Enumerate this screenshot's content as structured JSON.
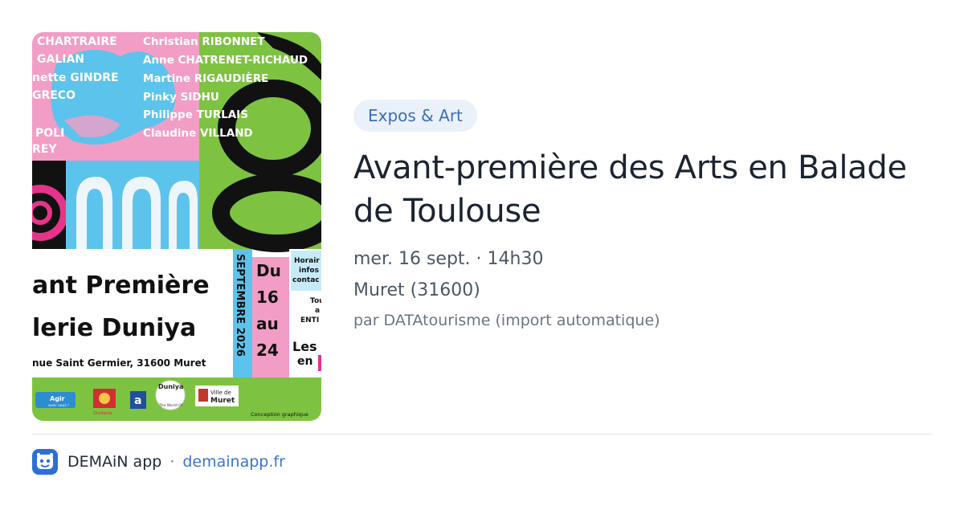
{
  "poster": {
    "names_left": [
      "CHARTRAIRE",
      "GALIAN",
      "nette GINDRE",
      "GRECO",
      "POLI",
      "REY"
    ],
    "names_right": [
      "Christian RIBONNET",
      "Anne CHATRENET-RICHAUD",
      "Martine RIGAUDIÈRE",
      "Pinky SIDHU",
      "Philippe TURLAIS",
      "Claudine VILLAND"
    ],
    "headline_1": "ant Première",
    "headline_2": "lerie Duniya",
    "address": "nue Saint Germier, 31600 Muret",
    "month_vertical": "SEPTEMBRE 2026",
    "date_du": "Du",
    "date_16": "16",
    "date_au": "au",
    "date_24": "24",
    "side_1": "Horair",
    "side_2": "infos",
    "side_3": "contac",
    "side_4": "Tou",
    "side_5": "a",
    "side_6": "ENTI",
    "side_7": "Les",
    "side_8": "en",
    "logo_agir": "Agir",
    "logo_agir_sub": "avec vous !",
    "logo_occitanie": "Occitanie",
    "logo_a": "a",
    "logo_duniya": "Duniya",
    "logo_duniya_sub": "The World Of",
    "logo_muret_1": "Ville de",
    "logo_muret_2": "Muret",
    "credit": "Conception graphique"
  },
  "event": {
    "category": "Expos & Art",
    "title": "Avant-première des Arts en Balade de Toulouse",
    "datetime": "mer. 16 sept. · 14h30",
    "location": "Muret (31600)",
    "source": "par DATAtourisme (import automatique)"
  },
  "footer": {
    "app_name": "DEMAiN app",
    "separator": "·",
    "site": "demainapp.fr"
  },
  "colors": {
    "accent": "#3b6fb6",
    "tag_bg": "#eaf1fb",
    "poster_pink": "#f29dc6",
    "poster_blue": "#5cc3ec",
    "poster_green": "#7ec242"
  },
  "icons": {
    "app": "demain-app-icon"
  }
}
